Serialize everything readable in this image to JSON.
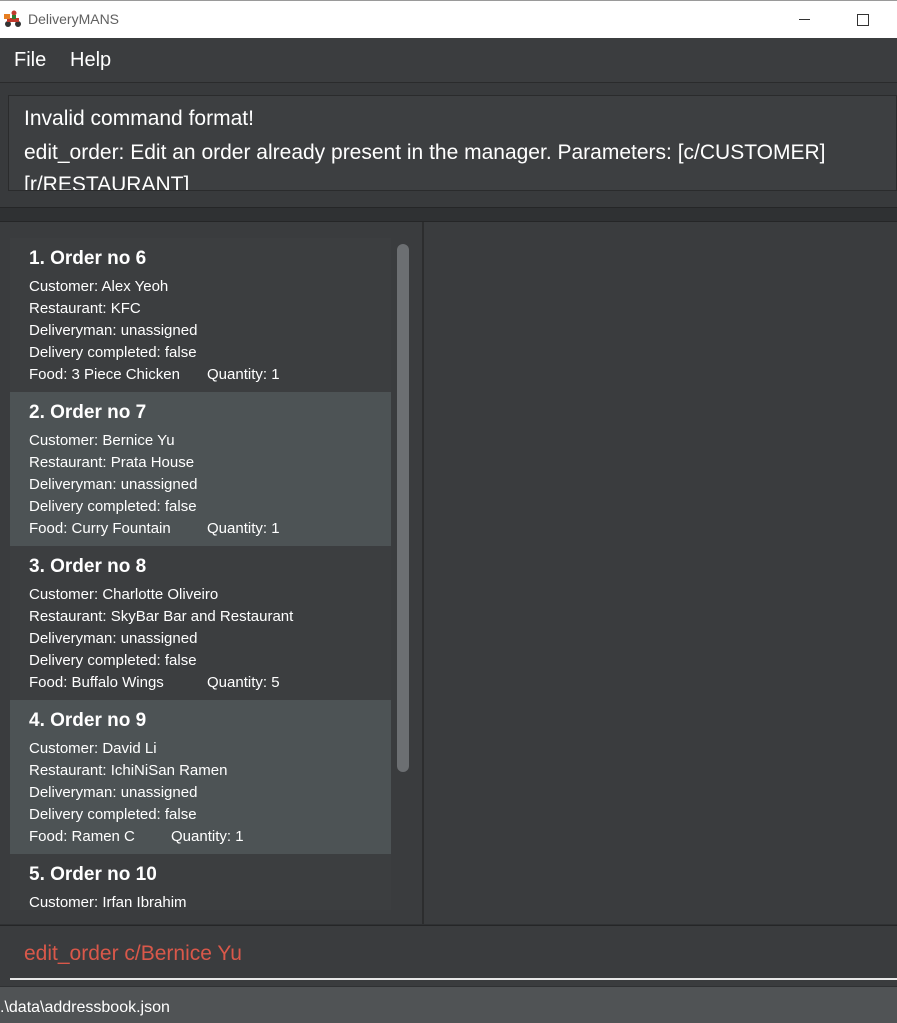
{
  "window": {
    "title": "DeliveryMANS"
  },
  "menu": {
    "items": [
      "File",
      "Help"
    ]
  },
  "result": {
    "lines": [
      "Invalid command format!",
      "edit_order: Edit an order already present in the manager. Parameters: [c/CUSTOMER]",
      "[r/RESTAURANT]"
    ]
  },
  "orders": [
    {
      "title": "1.  Order no 6",
      "customer": "Customer: Alex Yeoh",
      "restaurant": "Restaurant: KFC",
      "deliveryman": "Deliveryman: unassigned",
      "completed": "Delivery completed: false",
      "food": "Food: 3 Piece Chicken",
      "quantity": "Quantity: 1"
    },
    {
      "title": "2.  Order no 7",
      "customer": "Customer: Bernice Yu",
      "restaurant": "Restaurant: Prata House",
      "deliveryman": "Deliveryman: unassigned",
      "completed": "Delivery completed: false",
      "food": "Food: Curry Fountain",
      "quantity": "Quantity: 1"
    },
    {
      "title": "3.  Order no 8",
      "customer": "Customer: Charlotte Oliveiro",
      "restaurant": "Restaurant: SkyBar Bar and Restaurant",
      "deliveryman": "Deliveryman: unassigned",
      "completed": "Delivery completed: false",
      "food": "Food: Buffalo Wings",
      "quantity": "Quantity: 5"
    },
    {
      "title": "4.  Order no 9",
      "customer": "Customer: David Li",
      "restaurant": "Restaurant: IchiNiSan Ramen",
      "deliveryman": "Deliveryman: unassigned",
      "completed": "Delivery completed: false",
      "food": "Food: Ramen C",
      "quantity": "Quantity: 1"
    },
    {
      "title": "5.  Order no 10",
      "customer": "Customer: Irfan Ibrahim"
    }
  ],
  "command": {
    "value": "edit_order c/Bernice Yu"
  },
  "status": {
    "path": ".\\data\\addressbook.json"
  },
  "colors": {
    "background": "#2f3133",
    "card_alt": "#4d5355",
    "command_text": "#d9584a"
  },
  "icons": {
    "app": "delivery-scooter-icon",
    "minimize": "minimize-icon",
    "maximize": "maximize-icon"
  }
}
